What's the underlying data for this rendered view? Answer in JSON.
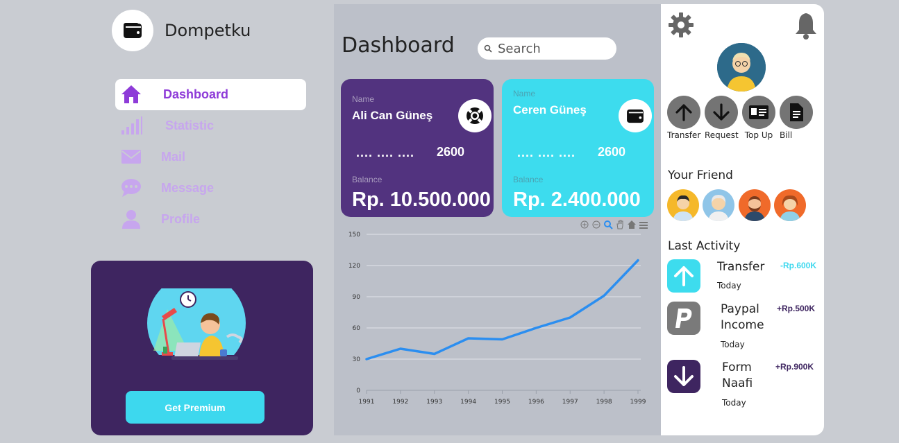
{
  "brand": {
    "title": "Dompetku",
    "icon": "wallet-icon"
  },
  "nav": [
    {
      "label": "Dashboard",
      "icon": "home-icon",
      "active": true
    },
    {
      "label": "Statistic",
      "icon": "signal-bars-icon",
      "active": false
    },
    {
      "label": "Mail",
      "icon": "envelope-icon",
      "active": false
    },
    {
      "label": "Message",
      "icon": "chat-icon",
      "active": false
    },
    {
      "label": "Profile",
      "icon": "user-icon",
      "active": false
    }
  ],
  "promo": {
    "button_label": "Get Premium"
  },
  "main": {
    "title": "Dashboard",
    "search": {
      "placeholder": "Search"
    }
  },
  "cards": [
    {
      "name_label": "Name",
      "name": "Ali Can Güneş",
      "dots": "....   ....   ....",
      "last_digits": "2600",
      "balance_label": "Balance",
      "balance": "Rp. 10.500.000",
      "icon": "lifebuoy-icon"
    },
    {
      "name_label": "Name",
      "name": "Ceren Güneş",
      "dots": "....   ....   ....",
      "last_digits": "2600",
      "balance_label": "Balance",
      "balance": "Rp. 2.400.000",
      "icon": "wallet-icon"
    }
  ],
  "chart_data": {
    "type": "line",
    "x": [
      "1991",
      "1992",
      "1993",
      "1994",
      "1995",
      "1996",
      "1997",
      "1998",
      "1999"
    ],
    "series": [
      {
        "values": [
          30,
          40,
          35,
          50,
          49,
          60,
          70,
          91,
          125
        ]
      }
    ],
    "yticks": [
      "0",
      "30",
      "60",
      "90",
      "120",
      "150"
    ],
    "ylim": [
      0,
      150
    ],
    "grid": true,
    "color": "#2b8ef0"
  },
  "quick_actions": [
    {
      "label": "Transfer",
      "icon": "arrow-up-icon"
    },
    {
      "label": "Request",
      "icon": "arrow-down-icon"
    },
    {
      "label": "Top Up",
      "icon": "id-card-icon"
    },
    {
      "label": "Bill",
      "icon": "document-icon"
    }
  ],
  "friends_title": "Your Friend",
  "activity_title": "Last Activity",
  "activities": [
    {
      "title": "Transfer",
      "time": "Today",
      "amount": "-Rp.600K",
      "icon": "arrow-up-icon",
      "color": "#3ddcee",
      "amount_color": "#3dd8ee"
    },
    {
      "title": "Paypal\nIncome",
      "title_1": "Paypal",
      "title_2": "Income",
      "time": "Today",
      "amount": "+Rp.500K",
      "icon": "paypal-icon",
      "color": "#7a7a7a",
      "amount_color": "#3e2560"
    },
    {
      "title_1": "Form",
      "title_2": "Naafi",
      "time": "Today",
      "amount": "+Rp.900K",
      "icon": "arrow-down-icon",
      "color": "#3e2560",
      "amount_color": "#3e2560"
    }
  ]
}
